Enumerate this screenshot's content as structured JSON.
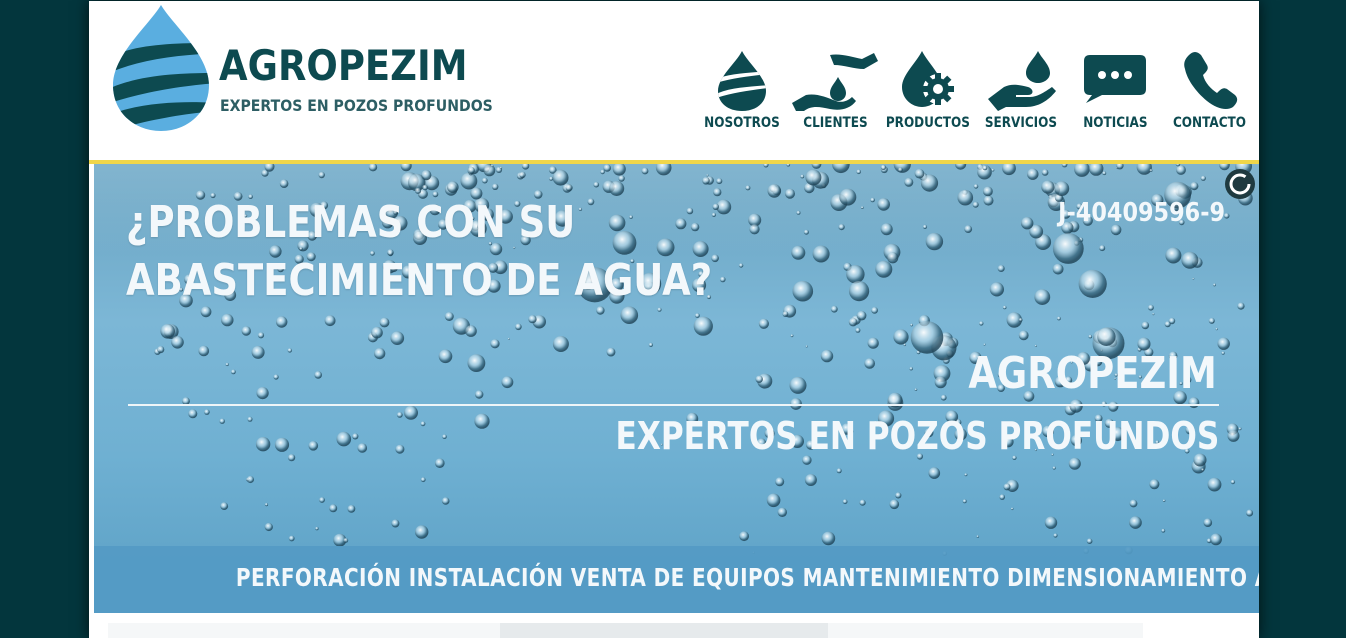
{
  "brand": {
    "name": "AGROPEZIM",
    "tagline": "EXPERTOS EN POZOS PROFUNDOS",
    "colors": {
      "dark_teal": "#0d4a50",
      "drop_blue": "#5aaee0",
      "accent_yellow": "#f0d64a",
      "background": "#03363d"
    }
  },
  "nav": {
    "items": [
      {
        "label": "NOSOTROS",
        "icon": "water-drop-icon"
      },
      {
        "label": "CLIENTES",
        "icon": "hands-drop-icon"
      },
      {
        "label": "PRODUCTOS",
        "icon": "drop-gear-icon"
      },
      {
        "label": "SERVICIOS",
        "icon": "hand-drop-icon"
      },
      {
        "label": "NOTICIAS",
        "icon": "chat-bubble-icon"
      },
      {
        "label": "CONTACTO",
        "icon": "phone-icon"
      }
    ]
  },
  "hero": {
    "headline_line1": "¿PROBLEMAS CON SU",
    "headline_line2": "ABASTECIMIENTO DE AGUA?",
    "rif": "J-40409596-9",
    "brand": "AGROPEZIM",
    "tagline": "EXPERTOS EN POZOS PROFUNDOS",
    "services": "PERFORACIÓN INSTALACIÓN VENTA DE EQUIPOS MANTENIMIENTO DIMENSIONAMIENTO ASESORÍA",
    "loader_icon": "loading-spinner-icon"
  }
}
